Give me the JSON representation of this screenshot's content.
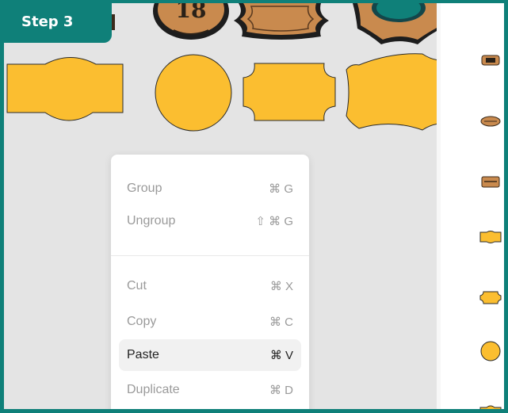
{
  "step_label": "Step 3",
  "colors": {
    "accent": "#0f8079",
    "shape_fill": "#fbbe30",
    "shape_stroke": "#2a2a2a",
    "wood": "#c98a4e"
  },
  "canvas_shapes": [
    "top-badge-shape",
    "circle-shape",
    "rounded-plaque-shape",
    "ornate-frame-shape"
  ],
  "layers_panel": {
    "items": [
      "wood-sign-1",
      "wood-sign-2",
      "wood-sign-3",
      "badge-shape",
      "rounded-plaque-shape",
      "circle-shape",
      "badge-shape-partial"
    ]
  },
  "context_menu": {
    "items": [
      {
        "label": "Group",
        "shortcut": "⌘ G"
      },
      {
        "label": "Ungroup",
        "shortcut": "⇧ ⌘ G"
      },
      {
        "label": "Cut",
        "shortcut": "⌘ X"
      },
      {
        "label": "Copy",
        "shortcut": "⌘ C"
      },
      {
        "label": "Paste",
        "shortcut": "⌘ V"
      },
      {
        "label": "Duplicate",
        "shortcut": "⌘ D"
      }
    ]
  }
}
